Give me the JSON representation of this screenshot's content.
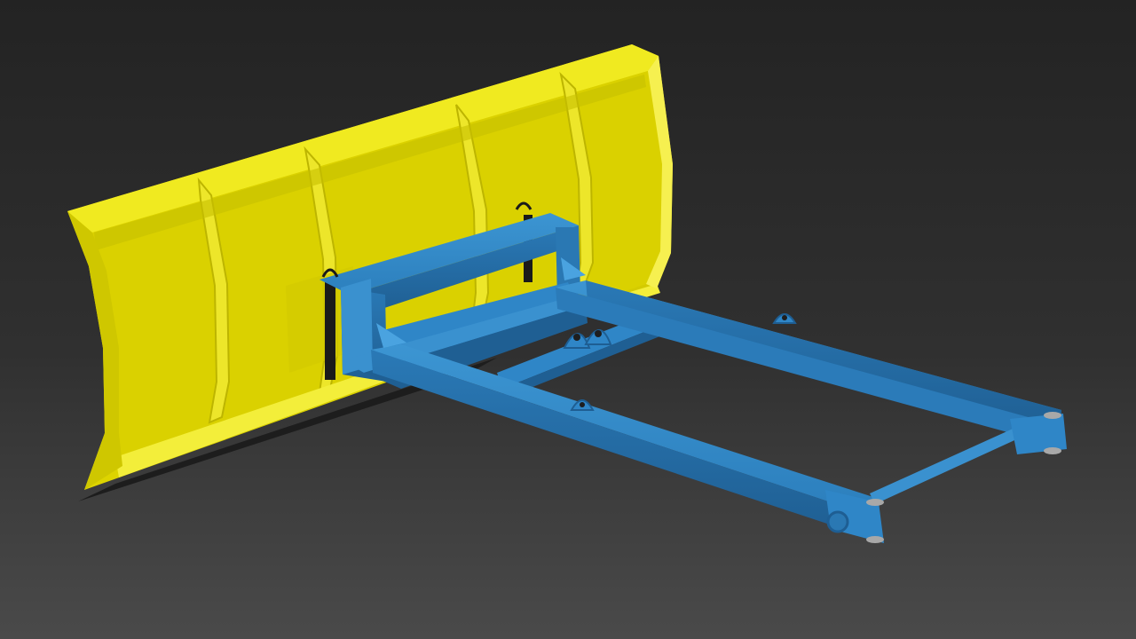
{
  "scene": {
    "colors": {
      "background_top": "#262626",
      "background_bottom": "#4a4a4a",
      "blade_yellow": "#E6E000",
      "blade_yellow_shadow": "#B9B400",
      "blade_yellow_highlight": "#F3EE3A",
      "frame_blue": "#2F86C7",
      "frame_blue_shadow": "#1E5E93",
      "frame_blue_highlight": "#4AA3E0",
      "cutting_edge_dark": "#1E1E1E",
      "steel": "#A8A8A8"
    },
    "objects": [
      "snow-plow-blade",
      "blue-mounting-frame",
      "pivot-pins",
      "lift-eyelets"
    ]
  }
}
